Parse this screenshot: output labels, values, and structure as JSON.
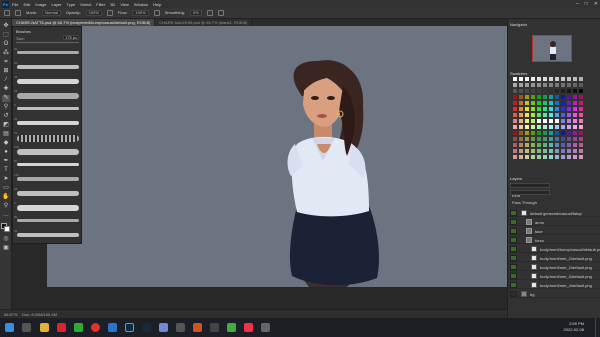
{
  "app": {
    "menu": [
      "File",
      "Edit",
      "Image",
      "Layer",
      "Type",
      "Select",
      "Filter",
      "3D",
      "View",
      "Window",
      "Help"
    ],
    "window_controls": [
      "–",
      "□",
      "✕"
    ]
  },
  "options_bar": {
    "mode_label": "Mode:",
    "mode_value": "Normal",
    "opacity_label": "Opacity:",
    "opacity_value": "100%",
    "flow_label": "Flow:",
    "flow_value": "100%",
    "smoothing_label": "Smoothing:",
    "smoothing_value": "0%"
  },
  "tabs": [
    {
      "label": "CHARE-NATT6.psd @ 66.7% (body/merit/bump/casual/default.png, RGB/8)",
      "active": true
    },
    {
      "label": "CHARE-NAUGHI6.psd @ 66.7% (blank1, RGB/8)",
      "active": false
    }
  ],
  "brushes_panel": {
    "title": "Brushes",
    "size_label": "Size:",
    "size_value": "175 px",
    "stroke_labels": [
      "30",
      "60",
      "45",
      "25",
      "9",
      "36",
      "70",
      "100",
      "50",
      "120",
      "28",
      "3",
      "80",
      "44"
    ]
  },
  "status_bar": {
    "zoom": "66.67%",
    "doc_info": "Doc: 8.03M/100.4M"
  },
  "right_panel": {
    "navigator_title": "Navigator",
    "swatches_title": "Swatches",
    "layers_title": "Layers",
    "layers_search": "Kind",
    "blend_mode": "Pass Through",
    "layers": [
      {
        "name": "default generate/casual/fatsy/",
        "visible": true,
        "indent": 0,
        "thumb": "white"
      },
      {
        "name": "arms",
        "visible": true,
        "indent": 1,
        "thumb": "folder"
      },
      {
        "name": "face",
        "visible": true,
        "indent": 1,
        "thumb": "folder"
      },
      {
        "name": "torso",
        "visible": true,
        "indent": 1,
        "thumb": "folder"
      },
      {
        "name": "body/merit/bump/casual/default.png",
        "visible": true,
        "indent": 2,
        "thumb": "white"
      },
      {
        "name": "body/merit/nee_2/default.png",
        "visible": true,
        "indent": 2,
        "thumb": "white"
      },
      {
        "name": "body/merit/nee_2/default.png",
        "visible": true,
        "indent": 2,
        "thumb": "white"
      },
      {
        "name": "body/merit/nee_3/default.png",
        "visible": true,
        "indent": 2,
        "thumb": "white"
      },
      {
        "name": "body/merit/nee_4/default.png",
        "visible": true,
        "indent": 2,
        "thumb": "white"
      },
      {
        "name": "bg",
        "visible": false,
        "indent": 0,
        "thumb": "gray"
      }
    ]
  },
  "taskbar": {
    "time": "2:59 PM",
    "date": "2022-02-08"
  },
  "colors": {
    "canvas_bg": "#6b7480",
    "accent": "#31a8ff",
    "shirt": "#e3e8f5",
    "skirt": "#1c2236",
    "hair": "#3b2520",
    "skin": "#d9a080"
  }
}
